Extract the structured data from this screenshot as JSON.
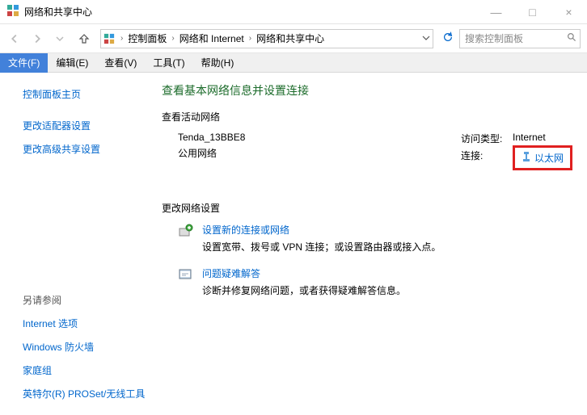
{
  "window": {
    "title": "网络和共享中心",
    "minimize": "—",
    "maximize": "□",
    "close": "×"
  },
  "breadcrumb": {
    "items": [
      "控制面板",
      "网络和 Internet",
      "网络和共享中心"
    ]
  },
  "search": {
    "placeholder": "搜索控制面板"
  },
  "menu": {
    "file": "文件(F)",
    "edit": "编辑(E)",
    "view": "查看(V)",
    "tools": "工具(T)",
    "help": "帮助(H)"
  },
  "sidebar": {
    "home": "控制面板主页",
    "adapter": "更改适配器设置",
    "advanced": "更改高级共享设置",
    "see_also": "另请参阅",
    "internet_options": "Internet 选项",
    "firewall": "Windows 防火墙",
    "homegroup": "家庭组",
    "intel": "英特尔(R) PROSet/无线工具"
  },
  "content": {
    "h1": "查看基本网络信息并设置连接",
    "h2_active": "查看活动网络",
    "network": {
      "name": "Tenda_13BBE8",
      "type": "公用网络",
      "access_label": "访问类型:",
      "access_value": "Internet",
      "conn_label": "连接:",
      "conn_value": "以太网"
    },
    "h2_change": "更改网络设置",
    "items": [
      {
        "title": "设置新的连接或网络",
        "desc": "设置宽带、拨号或 VPN 连接；或设置路由器或接入点。"
      },
      {
        "title": "问题疑难解答",
        "desc": "诊断并修复网络问题，或者获得疑难解答信息。"
      }
    ]
  }
}
